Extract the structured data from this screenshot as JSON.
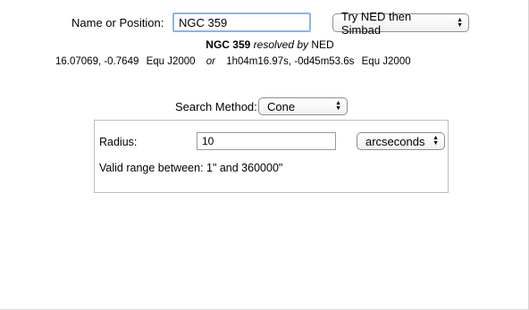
{
  "form": {
    "name_label": "Name or Position:",
    "name_value": "NGC 359",
    "resolver_selected": "Try NED then Simbad",
    "resolved": {
      "object": "NGC 359",
      "resolved_by_text": "resolved by",
      "service": "NED"
    },
    "coords": {
      "decimal": "16.07069, -0.7649",
      "decimal_frame": "Equ J2000",
      "or_text": "or",
      "sexagesimal": "1h04m16.97s, -0d45m53.6s",
      "sexagesimal_frame": "Equ J2000"
    },
    "search_method_label": "Search Method:",
    "search_method_selected": "Cone",
    "cone": {
      "radius_label": "Radius:",
      "radius_value": "10",
      "units_selected": "arcseconds",
      "valid_range_text": "Valid range between: 1\" and 360000\""
    }
  },
  "icons": {
    "select_arrows": "up-down-arrows-icon"
  }
}
